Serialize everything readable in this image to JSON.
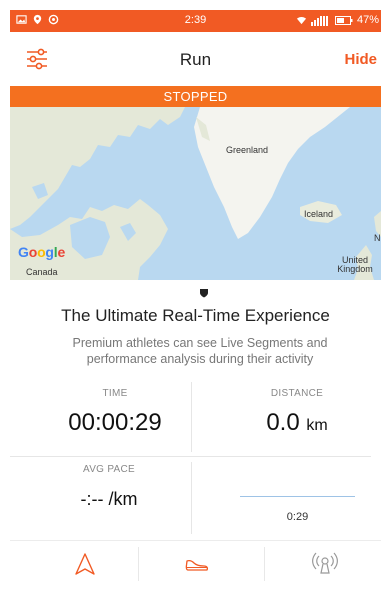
{
  "status_bar": {
    "time": "2:39",
    "battery": "47%",
    "color": "#f15a24"
  },
  "header": {
    "title": "Run",
    "hide_label": "Hide",
    "filter_icon": "sliders-icon"
  },
  "state": {
    "label": "STOPPED",
    "color": "#f4701f"
  },
  "map": {
    "labels": {
      "greenland": "Greenland",
      "iceland": "Iceland",
      "canada": "Canada",
      "united_kingdom": "United Kingdom",
      "edge_letter": "N"
    },
    "google": [
      "G",
      "o",
      "o",
      "g",
      "l",
      "e"
    ]
  },
  "promo": {
    "title": "The Ultimate Real-Time Experience",
    "description": "Premium athletes can see Live Segments and performance analysis during their activity"
  },
  "stats": {
    "time": {
      "label": "TIME",
      "value": "00:00:29"
    },
    "distance": {
      "label": "DISTANCE",
      "value": "0.0",
      "unit": "km"
    },
    "avg_pace": {
      "label": "AVG PACE",
      "value": "-:-- /km"
    },
    "chart_time": "0:29"
  },
  "tabs": [
    {
      "name": "navigation-icon"
    },
    {
      "name": "shoe-icon"
    },
    {
      "name": "beacon-icon"
    }
  ],
  "accent_color": "#f15a24"
}
